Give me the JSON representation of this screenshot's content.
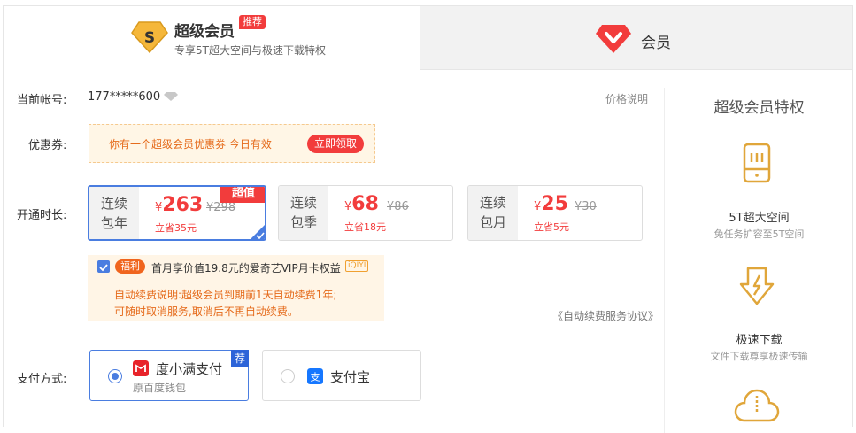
{
  "tabs": {
    "super": {
      "title": "超级会员",
      "tag": "推荐",
      "subtitle": "专享5T超大空间与极速下载特权"
    },
    "normal": {
      "title": "会员"
    }
  },
  "account": {
    "label": "当前帐号:",
    "value": "177*****600"
  },
  "price_note": "价格说明",
  "coupon": {
    "label": "优惠券:",
    "text": "你有一个超级会员优惠券  今日有效",
    "button": "立即领取"
  },
  "duration": {
    "label": "开通时长:",
    "plans": [
      {
        "name1": "连续",
        "name2": "包年",
        "price": "263",
        "currency": "¥",
        "original": "¥298",
        "save": "立省35元",
        "tag": "超值",
        "selected": true
      },
      {
        "name1": "连续",
        "name2": "包季",
        "price": "68",
        "currency": "¥",
        "original": "¥86",
        "save": "立省18元",
        "selected": false
      },
      {
        "name1": "连续",
        "name2": "包月",
        "price": "25",
        "currency": "¥",
        "original": "¥30",
        "save": "立省5元",
        "selected": false
      }
    ]
  },
  "perk": {
    "checked": true,
    "tag": "福利",
    "text": "首月享价值19.8元的爱奇艺VIP月卡权益",
    "logo": "iQIYI",
    "desc1": "自动续费说明:超级会员到期前1天自动续费1年;",
    "desc2": "可随时取消服务,取消后不再自动续费。"
  },
  "agreement": "《自动续费服务协议》",
  "payment": {
    "label": "支付方式:",
    "methods": [
      {
        "name": "度小满支付",
        "sub": "原百度钱包",
        "rec": "荐",
        "selected": true,
        "icon": "duxiaoman-icon"
      },
      {
        "name": "支付宝",
        "selected": false,
        "icon": "alipay-icon"
      }
    ]
  },
  "sidebar": {
    "title": "超级会员特权",
    "features": [
      {
        "name": "5T超大空间",
        "sub": "免任务扩容至5T空间",
        "icon": "storage-icon"
      },
      {
        "name": "极速下载",
        "sub": "文件下载尊享极速传输",
        "icon": "download-icon"
      },
      {
        "name": "",
        "sub": "",
        "icon": "cloud-icon"
      }
    ]
  },
  "colors": {
    "accent": "#4a7de0",
    "red": "#f23c3c",
    "gold": "#e0a63a"
  }
}
